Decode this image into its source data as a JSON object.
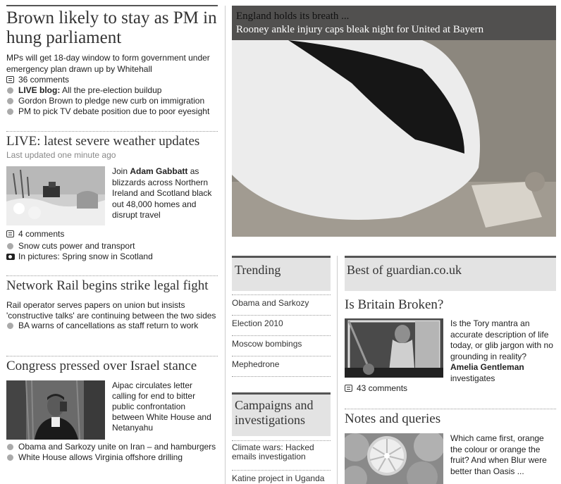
{
  "left": {
    "story1": {
      "headline": "Brown likely to stay as PM in hung parliament",
      "standfirst_a": "MPs will get 18-day window to form government under",
      "standfirst_b": "emergency plan drawn up by Whitehall",
      "comments": "36 comments",
      "links": [
        {
          "bold": "LIVE blog:",
          "text": " All the pre-election buildup"
        },
        {
          "bold": "",
          "text": "Gordon Brown to pledge new curb on immigration"
        },
        {
          "bold": "",
          "text": "PM to pick TV debate position due to poor eyesight"
        }
      ]
    },
    "story2": {
      "headline": "LIVE: latest severe weather updates",
      "updated": "Last updated one minute ago",
      "body_pre": "Join ",
      "body_bold": "Adam Gabbatt",
      "body_post": " as blizzards across Northern Ireland and Scotland black out 48,000 homes and disrupt travel",
      "comments": "4 comments",
      "link1": "Snow cuts power and transport",
      "link2": "In pictures: Spring snow in Scotland"
    },
    "story3": {
      "headline": "Network Rail begins strike legal fight",
      "body": "Rail operator serves papers on union but insists 'constructive talks' are continuing between the two sides",
      "link1": "BA warns of cancellations as staff return to work"
    },
    "story4": {
      "headline": "Congress pressed over Israel stance",
      "body": "Aipac circulates letter calling for end to bitter public confrontation between White House and Netanyahu",
      "link1": "Obama and Sarkozy unite on Iran – and hamburgers",
      "link2": "White House allows Virginia offshore drilling"
    }
  },
  "hero": {
    "kicker": "England holds its breath ...",
    "headline": "Rooney ankle injury caps bleak night for United at Bayern"
  },
  "trending": {
    "title": "Trending",
    "items": [
      "Obama and Sarkozy",
      "Election 2010",
      "Moscow bombings",
      "Mephedrone"
    ]
  },
  "campaigns": {
    "title": "Campaigns and investigations",
    "items": [
      "Climate wars: Hacked emails investigation",
      "Katine project in Uganda"
    ]
  },
  "best": {
    "title": "Best of guardian.co.uk",
    "story1": {
      "headline": "Is Britain Broken?",
      "body": "Is the Tory mantra an accurate description of life today, or glib jargon with no grounding in reality?",
      "author": "Amelia Gentleman",
      "author_post": "investigates",
      "comments": "43 comments"
    },
    "story2": {
      "headline": "Notes and queries",
      "body": "Which came first, orange the colour or orange the fruit? And when Blur were better than Oasis ..."
    }
  }
}
